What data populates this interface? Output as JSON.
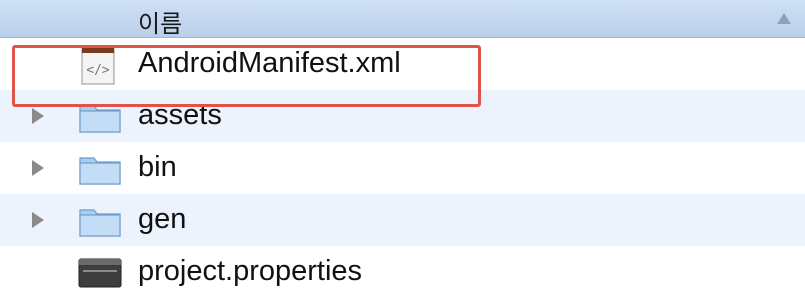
{
  "header": {
    "column_name": "이름",
    "sort_icon": "sort-ascending-icon"
  },
  "files": [
    {
      "name": "AndroidManifest.xml",
      "type": "xml-file",
      "icon": "xml-file-icon",
      "expandable": false,
      "highlighted": true
    },
    {
      "name": "assets",
      "type": "folder",
      "icon": "folder-icon",
      "expandable": true
    },
    {
      "name": "bin",
      "type": "folder",
      "icon": "folder-icon",
      "expandable": true
    },
    {
      "name": "gen",
      "type": "folder",
      "icon": "folder-icon",
      "expandable": true
    },
    {
      "name": "project.properties",
      "type": "properties-file",
      "icon": "properties-file-icon",
      "expandable": false
    }
  ],
  "colors": {
    "header_bg": "#c3d7ef",
    "alt_row_bg": "#edf3fc",
    "highlight_border": "#e0534a",
    "folder_blue": "#9ec3e8"
  }
}
